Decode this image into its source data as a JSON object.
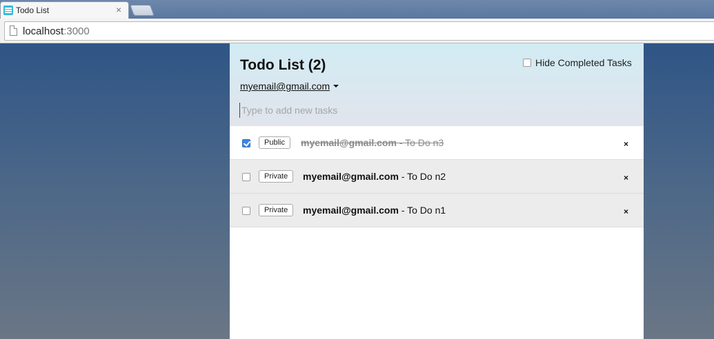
{
  "browser": {
    "tab_title": "Todo List",
    "tab_close": "×",
    "url_host": "localhost",
    "url_port": ":3000"
  },
  "app": {
    "title": "Todo List (2)",
    "hide_completed_label": "Hide Completed Tasks",
    "hide_completed_checked": false,
    "user_email": "myemail@gmail.com",
    "new_task_placeholder": "Type to add new tasks",
    "new_task_value": ""
  },
  "tasks": [
    {
      "checked": true,
      "privacy": "Public",
      "owner": "myemail@gmail.com",
      "text": " - To Do n3",
      "delete": "×"
    },
    {
      "checked": false,
      "privacy": "Private",
      "owner": "myemail@gmail.com",
      "text": " - To Do n2",
      "delete": "×"
    },
    {
      "checked": false,
      "privacy": "Private",
      "owner": "myemail@gmail.com",
      "text": " - To Do n1",
      "delete": "×"
    }
  ],
  "icons": {
    "favicon": "list-icon",
    "page": "page-icon",
    "user_menu": "chevron-down-icon",
    "delete": "close-icon"
  },
  "colors": {
    "checkbox_checked": "#3a86e8",
    "header_bg_top": "#d2ecf4",
    "page_bg": "#2f5586"
  }
}
